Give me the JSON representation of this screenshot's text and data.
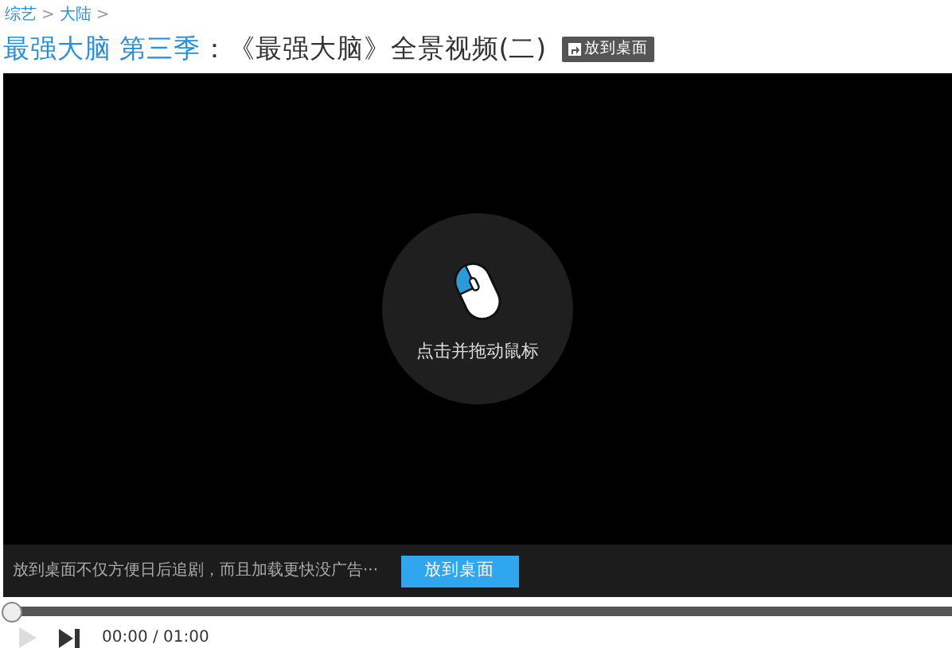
{
  "breadcrumb": [
    {
      "label": "综艺",
      "sep": ">"
    },
    {
      "label": "大陆",
      "sep": ">"
    }
  ],
  "title": {
    "show": "最强大脑 第三季",
    "episode": "：《最强大脑》全景视频(二)"
  },
  "desktop_button": {
    "label": "放到桌面"
  },
  "player": {
    "hint": "点击并拖动鼠标",
    "banner": {
      "text": "放到桌面不仅方便日后追剧，而且加载更快没广告···",
      "button": "放到桌面"
    },
    "progress": {
      "level": 0.0
    },
    "time": "00:00 / 01:00"
  }
}
